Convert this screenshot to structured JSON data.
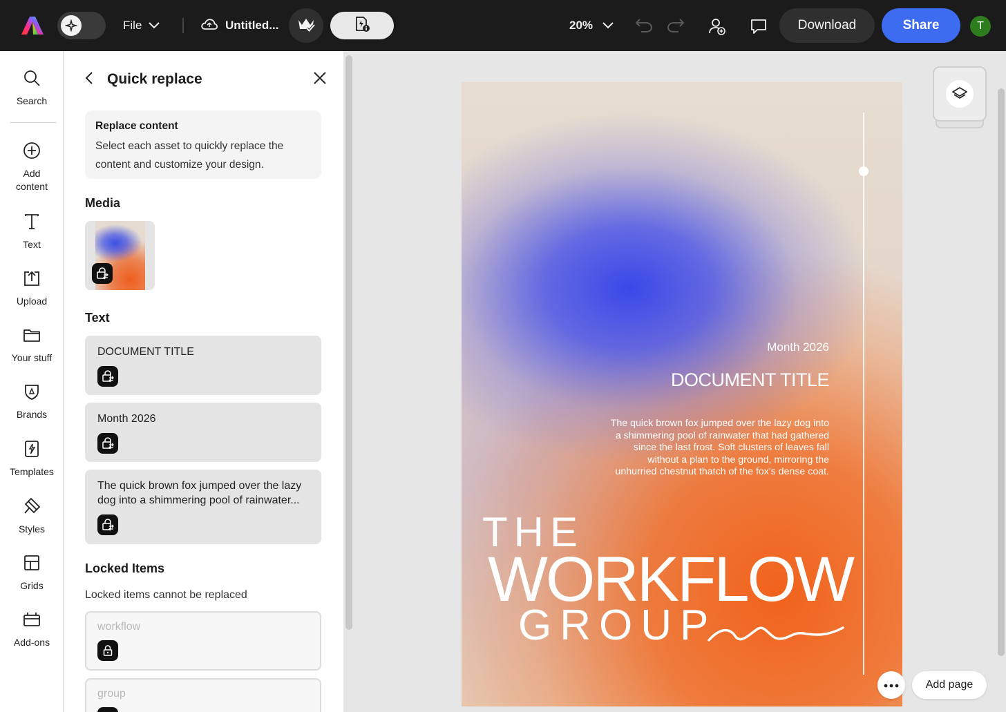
{
  "topbar": {
    "file_label": "File",
    "doc_title": "Untitled...",
    "zoom": "20%",
    "download_label": "Download",
    "share_label": "Share",
    "avatar_initial": "T",
    "colors": {
      "background": "#1b1b1b",
      "share": "#3d6cf0",
      "avatar": "#2d7d1e"
    }
  },
  "rail": {
    "items": [
      {
        "label": "Search",
        "icon": "search-icon"
      },
      {
        "label": "Add content",
        "icon": "add-content-icon"
      },
      {
        "label": "Text",
        "icon": "text-icon"
      },
      {
        "label": "Upload",
        "icon": "upload-icon"
      },
      {
        "label": "Your stuff",
        "icon": "folder-icon"
      },
      {
        "label": "Brands",
        "icon": "brand-icon"
      },
      {
        "label": "Templates",
        "icon": "templates-icon"
      },
      {
        "label": "Styles",
        "icon": "styles-icon"
      },
      {
        "label": "Grids",
        "icon": "grid-icon"
      },
      {
        "label": "Add-ons",
        "icon": "addons-icon"
      }
    ]
  },
  "panel": {
    "title": "Quick replace",
    "info_heading": "Replace content",
    "info_body": "Select each asset to quickly replace the content and customize your design.",
    "media_heading": "Media",
    "text_heading": "Text",
    "text_items": [
      "DOCUMENT TITLE",
      "Month 2026",
      "The quick brown fox jumped over the lazy dog into a shimmering pool of rainwater..."
    ],
    "locked_heading": "Locked Items",
    "locked_note": "Locked items cannot be replaced",
    "locked_items": [
      "workflow",
      "group"
    ]
  },
  "canvas": {
    "month": "Month 2026",
    "title": "DOCUMENT TITLE",
    "body": "The quick brown fox jumped over the lazy dog into a shimmering pool of rainwater that had gathered since the last frost. Soft clusters of leaves fall without a plan to the ground, mirroring the unhurried chestnut thatch of the fox's dense coat.",
    "headline_the": "THE",
    "headline_workflow": "WORKFLOW",
    "headline_group": "GROUP",
    "add_page_label": "Add page"
  }
}
